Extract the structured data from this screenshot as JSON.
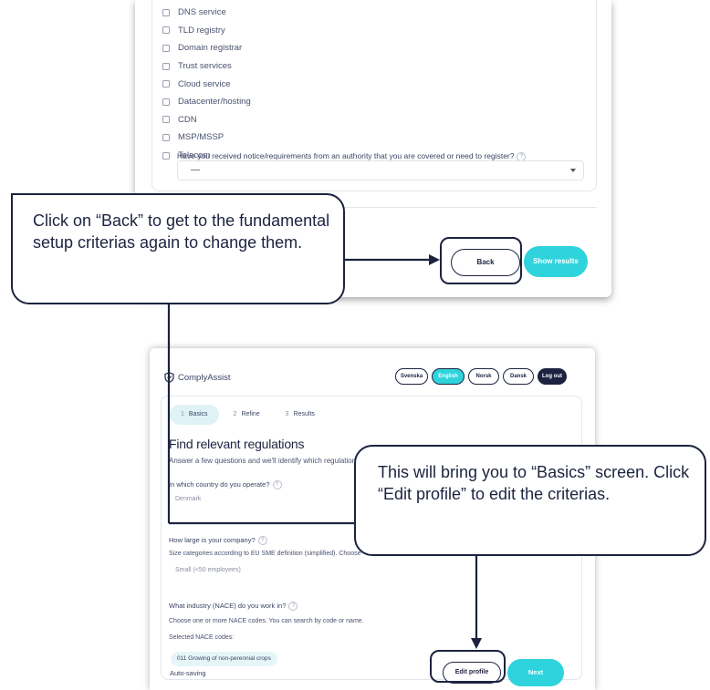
{
  "top_screen": {
    "checkbox_options": [
      "DNS service",
      "TLD registry",
      "Domain registrar",
      "Trust services",
      "Cloud service",
      "Datacenter/hosting",
      "CDN",
      "MSP/MSSP",
      "Telecom"
    ],
    "authority_question": "Have you received notice/requirements from an authority that you are covered or need to register?",
    "help_glyph": "?",
    "authority_select_value": "—",
    "back_button": "Back",
    "show_results_button": "Show results"
  },
  "bottom_screen": {
    "brand": "ComplyAssist",
    "languages": [
      "Svenska",
      "English",
      "Norsk",
      "Dansk"
    ],
    "active_language": "English",
    "logout_button": "Log out",
    "steps": [
      {
        "num": "1",
        "label": "Basics"
      },
      {
        "num": "2",
        "label": "Refine"
      },
      {
        "num": "3",
        "label": "Results"
      }
    ],
    "title": "Find relevant regulations",
    "subtitle": "Answer a few questions and we'll identify which regulations",
    "country_question": "In which country do you operate?",
    "country_value": "Denmark",
    "size_question": "How large is your company?",
    "size_hint": "Size categories according to EU SME definition (simplified). Choose",
    "size_value": "Small (<50 employees)",
    "industry_question": "What industry (NACE) do you work in?",
    "industry_hint": "Choose one or more NACE codes. You can search by code or name.",
    "selected_label": "Selected NACE codes:",
    "selected_chip": "011 Growing of non-perennial crops",
    "autosave": "Auto-saving",
    "edit_profile_button": "Edit profile",
    "next_button": "Next"
  },
  "annotations": {
    "callout_back": "Click on “Back” to get to the fundamental setup criterias again to change them.",
    "callout_basics": "This will bring you to “Basics” screen. Click “Edit profile” to edit the criterias."
  },
  "colors": {
    "navy": "#1c2340",
    "teal": "#2ed3dc"
  }
}
